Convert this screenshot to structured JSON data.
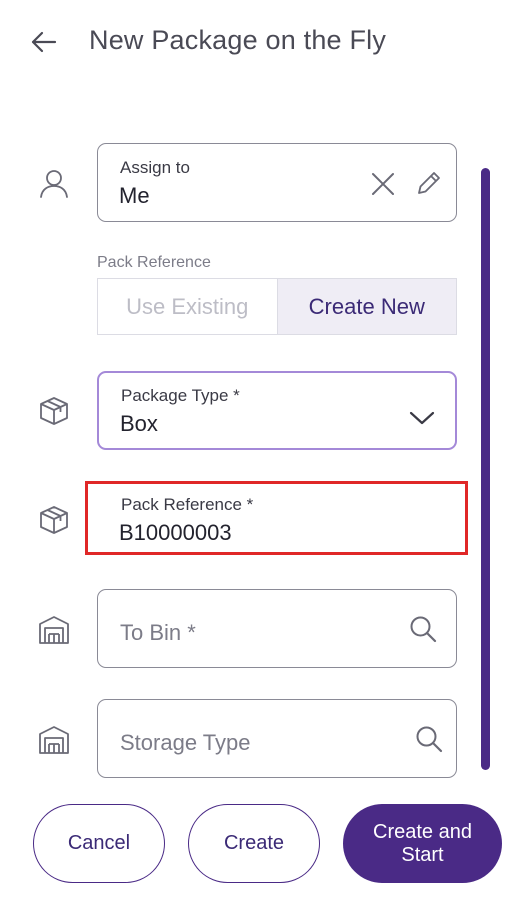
{
  "header": {
    "title": "New Package on the Fly"
  },
  "assign": {
    "label": "Assign to",
    "value": "Me"
  },
  "pack_reference_toggle": {
    "label": "Pack Reference",
    "options": [
      "Use Existing",
      "Create New"
    ],
    "selected": "Create New"
  },
  "package_type": {
    "label": "Package Type *",
    "value": "Box"
  },
  "pack_reference": {
    "label": "Pack Reference *",
    "value": "B10000003"
  },
  "to_bin": {
    "placeholder": "To Bin *"
  },
  "storage_type": {
    "placeholder": "Storage Type"
  },
  "actions": {
    "cancel": "Cancel",
    "create": "Create",
    "create_and_start": "Create and Start"
  },
  "colors": {
    "primary": "#4a2a86",
    "focus_border": "#a489d8",
    "highlight": "#e02828",
    "selected_segment_bg": "#efedf5"
  },
  "icons": {
    "back": "arrow-left-icon",
    "assign": "person-icon",
    "clear": "close-icon",
    "edit": "pencil-icon",
    "package": "box-icon",
    "dropdown": "chevron-down-icon",
    "bin": "warehouse-icon",
    "search": "search-icon"
  }
}
